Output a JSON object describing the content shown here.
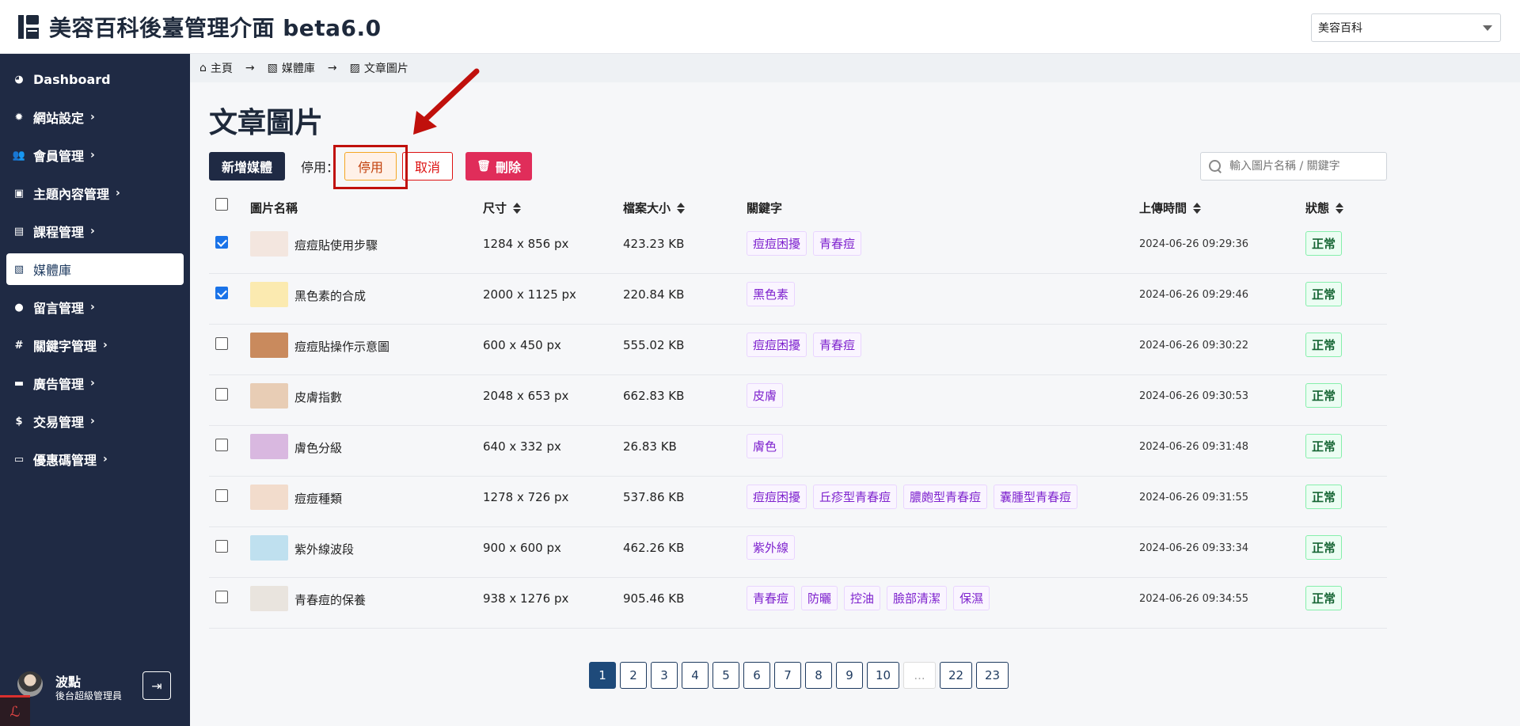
{
  "header": {
    "title": "美容百科後臺管理介面 beta6.0",
    "site_select": "美容百科"
  },
  "sidebar": {
    "items": [
      {
        "label": "Dashboard",
        "icon": "dashboard-icon",
        "chevron": false,
        "active": false
      },
      {
        "label": "網站設定",
        "icon": "gear-icon",
        "chevron": true,
        "active": false
      },
      {
        "label": "會員管理",
        "icon": "users-icon",
        "chevron": true,
        "active": false
      },
      {
        "label": "主題內容管理",
        "icon": "content-icon",
        "chevron": true,
        "active": false
      },
      {
        "label": "課程管理",
        "icon": "book-icon",
        "chevron": true,
        "active": false
      },
      {
        "label": "媒體庫",
        "icon": "images-icon",
        "chevron": false,
        "active": true
      },
      {
        "label": "留言管理",
        "icon": "comment-icon",
        "chevron": true,
        "active": false
      },
      {
        "label": "關鍵字管理",
        "icon": "hashtag-icon",
        "chevron": true,
        "active": false
      },
      {
        "label": "廣告管理",
        "icon": "ad-icon",
        "chevron": true,
        "active": false
      },
      {
        "label": "交易管理",
        "icon": "money-bag-icon",
        "chevron": true,
        "active": false
      },
      {
        "label": "優惠碼管理",
        "icon": "ticket-icon",
        "chevron": true,
        "active": false
      }
    ],
    "user": {
      "name": "波點",
      "role": "後台超級管理員"
    }
  },
  "breadcrumb": [
    {
      "label": "主頁",
      "icon": "home-icon"
    },
    {
      "label": "媒體庫",
      "icon": "images-icon"
    },
    {
      "label": "文章圖片",
      "icon": "image-icon"
    }
  ],
  "page": {
    "title": "文章圖片",
    "new_button": "新增媒體",
    "disable_label": "停用：",
    "disable_button": "停用",
    "cancel_button": "取消",
    "delete_button": "刪除",
    "search_placeholder": "輸入圖片名稱 / 關鍵字"
  },
  "table": {
    "headers": {
      "name": "圖片名稱",
      "size": "尺寸",
      "file_size": "檔案大小",
      "keywords": "關鍵字",
      "uploaded": "上傳時間",
      "status": "狀態"
    },
    "rows": [
      {
        "checked": true,
        "name": "痘痘貼使用步驟",
        "size": "1284 x 856 px",
        "file_size": "423.23 KB",
        "tags": [
          "痘痘困擾",
          "青春痘"
        ],
        "uploaded": "2024-06-26 09:29:36",
        "status": "正常",
        "thumb": "#f3e6df"
      },
      {
        "checked": true,
        "name": "黑色素的合成",
        "size": "2000 x 1125 px",
        "file_size": "220.84 KB",
        "tags": [
          "黑色素"
        ],
        "uploaded": "2024-06-26 09:29:46",
        "status": "正常",
        "thumb": "#fbeab0"
      },
      {
        "checked": false,
        "name": "痘痘貼操作示意圖",
        "size": "600 x 450 px",
        "file_size": "555.02 KB",
        "tags": [
          "痘痘困擾",
          "青春痘"
        ],
        "uploaded": "2024-06-26 09:30:22",
        "status": "正常",
        "thumb": "#c98a5d"
      },
      {
        "checked": false,
        "name": "皮膚指數",
        "size": "2048 x 653 px",
        "file_size": "662.83 KB",
        "tags": [
          "皮膚"
        ],
        "uploaded": "2024-06-26 09:30:53",
        "status": "正常",
        "thumb": "#e8cdb5"
      },
      {
        "checked": false,
        "name": "膚色分級",
        "size": "640 x 332 px",
        "file_size": "26.83 KB",
        "tags": [
          "膚色"
        ],
        "uploaded": "2024-06-26 09:31:48",
        "status": "正常",
        "thumb": "#d9b8e0"
      },
      {
        "checked": false,
        "name": "痘痘種類",
        "size": "1278 x 726 px",
        "file_size": "537.86 KB",
        "tags": [
          "痘痘困擾",
          "丘疹型青春痘",
          "膿皰型青春痘",
          "囊腫型青春痘"
        ],
        "uploaded": "2024-06-26 09:31:55",
        "status": "正常",
        "thumb": "#f2dccc"
      },
      {
        "checked": false,
        "name": "紫外線波段",
        "size": "900 x 600 px",
        "file_size": "462.26 KB",
        "tags": [
          "紫外線"
        ],
        "uploaded": "2024-06-26 09:33:34",
        "status": "正常",
        "thumb": "#bfe0ef"
      },
      {
        "checked": false,
        "name": "青春痘的保養",
        "size": "938 x 1276 px",
        "file_size": "905.46 KB",
        "tags": [
          "青春痘",
          "防曬",
          "控油",
          "臉部清潔",
          "保濕"
        ],
        "uploaded": "2024-06-26 09:34:55",
        "status": "正常",
        "thumb": "#e9e4de"
      }
    ]
  },
  "pagination": {
    "pages": [
      "1",
      "2",
      "3",
      "4",
      "5",
      "6",
      "7",
      "8",
      "9",
      "10",
      "...",
      "22",
      "23"
    ],
    "current": "1"
  },
  "colors": {
    "sidebar_bg": "#1f2a44",
    "tag_text": "#7e22ce",
    "status_text": "#166534",
    "delete_button": "#e02d5a",
    "annotation": "#c0100c"
  }
}
